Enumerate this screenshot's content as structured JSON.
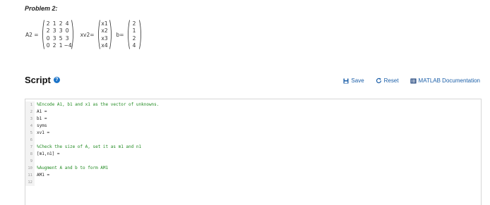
{
  "problem": {
    "title": "Problem 2:",
    "a2_label": "A2 =",
    "a2_matrix": [
      "2",
      "1",
      "2",
      "4",
      "2",
      "3",
      "3",
      "0",
      "0",
      "3",
      "5",
      "3",
      "0",
      "2",
      "1",
      "−4"
    ],
    "xv2_label": "xv2=",
    "xv2_vector": [
      "x1",
      "x2",
      "x3",
      "x4"
    ],
    "b_label": "b=",
    "b_vector": [
      "2",
      "1",
      "2",
      "4"
    ]
  },
  "script": {
    "title": "Script",
    "help_icon": "question-circle-icon",
    "save_label": "Save",
    "reset_label": "Reset",
    "docs_label": "MATLAB Documentation",
    "accent_color": "#1a5ea8",
    "comment_color": "#228b22"
  },
  "editor": {
    "lines": [
      {
        "num": "1",
        "text": "%Encode A1, b1 and x1 as the vector of unknowns."
      },
      {
        "num": "2",
        "text": "A1 ="
      },
      {
        "num": "3",
        "text": "b1 ="
      },
      {
        "num": "4",
        "text": "syms"
      },
      {
        "num": "5",
        "text": "xv1 ="
      },
      {
        "num": "6",
        "text": ""
      },
      {
        "num": "7",
        "text": "%Check the size of A, set it as m1 and n1"
      },
      {
        "num": "8",
        "text": "[m1,n1] ="
      },
      {
        "num": "9",
        "text": ""
      },
      {
        "num": "10",
        "text": "%Augment A and b to form AM1"
      },
      {
        "num": "11",
        "text": "AM1 ="
      },
      {
        "num": "12",
        "text": ""
      }
    ]
  }
}
